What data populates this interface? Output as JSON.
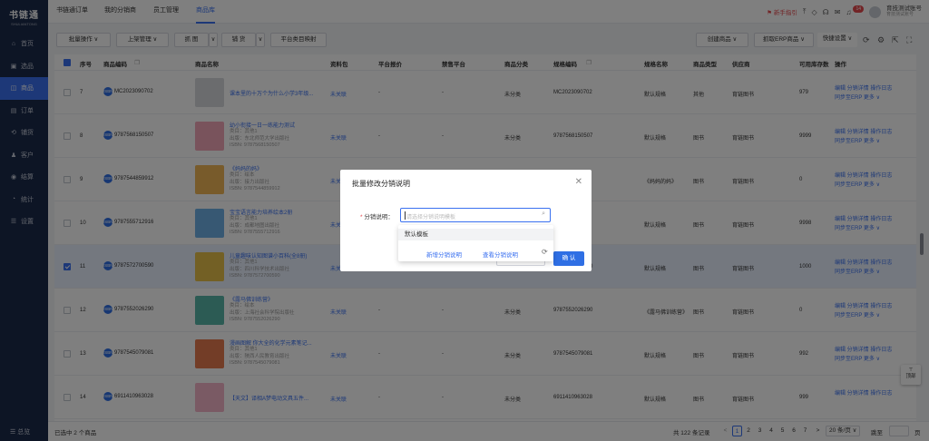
{
  "sidebar": {
    "logo": "书链通",
    "logo_sub": "SHULIANTONG",
    "items": [
      {
        "icon": "home-icon",
        "glyph": "⌂",
        "label": "首页"
      },
      {
        "icon": "selection-icon",
        "glyph": "▣",
        "label": "选品"
      },
      {
        "icon": "product-icon",
        "glyph": "◫",
        "label": "商品"
      },
      {
        "icon": "order-icon",
        "glyph": "▤",
        "label": "订单"
      },
      {
        "icon": "distribution-icon",
        "glyph": "⟲",
        "label": "铺货"
      },
      {
        "icon": "customer-icon",
        "glyph": "♟",
        "label": "客户"
      },
      {
        "icon": "settlement-icon",
        "glyph": "◉",
        "label": "结算"
      },
      {
        "icon": "stats-icon",
        "glyph": "◔",
        "label": "统计"
      },
      {
        "icon": "settings-icon",
        "glyph": "☰",
        "label": "设置"
      }
    ],
    "bottom": "☰ 总览"
  },
  "header": {
    "tabs": [
      "书链通订单",
      "我的分销商",
      "员工管理",
      "商品库"
    ],
    "guide": "新手指引",
    "badge": "14",
    "account_name": "育技测试账号",
    "account_sub": "育技测试账号"
  },
  "toolbar": {
    "batch": "批量操作 ∨",
    "listing": "上架管理 ∨",
    "capture": "抓 图",
    "distribute": "铺 货",
    "platform_map": "平台类目映射",
    "create": "创建商品 ∨",
    "capture_erp": "抓取ERP商品 ∨",
    "quick": "快捷设置 ∨"
  },
  "table": {
    "headers": [
      "序号",
      "商品编码",
      "商品名称",
      "资料包",
      "平台报价",
      "禁售平台",
      "商品分类",
      "规格编码",
      "规格名称",
      "商品类型",
      "供应商",
      "可用库存数",
      "操作"
    ],
    "rows": [
      {
        "no": "7",
        "code": "MC2023090702",
        "name": "课本里的十万个为什么小学3年级...",
        "info": [],
        "pkg": "未关联",
        "price": "-",
        "banned": "-",
        "cat": "未分类",
        "sku": "MC2023090702",
        "spec": "默认规格",
        "type": "其他",
        "supplier": "育链图书",
        "stock": "979",
        "op1": "编辑  分销详情  操作日志",
        "op2": "同步至ERP  更多 ∨",
        "thumb": "#d7d9dd",
        "selected": false
      },
      {
        "no": "8",
        "code": "9787568150507",
        "name": "幼小衔接一日一练能力测试",
        "info": [
          "类目：其他1",
          "出版：东北师范大学出版社",
          "ISBN: 9787568150507"
        ],
        "pkg": "未关联",
        "price": "-",
        "banned": "-",
        "cat": "未分类",
        "sku": "9787568150507",
        "spec": "默认规格",
        "type": "图书",
        "supplier": "育链图书",
        "stock": "9999",
        "op1": "编辑  分销详情  操作日志",
        "op2": "同步至ERP  更多 ∨",
        "thumb": "#f2a6b8",
        "selected": false
      },
      {
        "no": "9",
        "code": "9787544859912",
        "name": "《妈妈的妈》",
        "info": [
          "类目：绘本",
          "出版：接力出版社",
          "ISBN: 9787544859912"
        ],
        "pkg": "未关联",
        "price": "",
        "banned": "",
        "cat": "",
        "sku": "",
        "spec": "《妈妈的妈》",
        "type": "图书",
        "supplier": "育链图书",
        "stock": "0",
        "op1": "编辑  分销详情  操作日志",
        "op2": "同步至ERP  更多 ∨",
        "thumb": "#f0b657",
        "selected": false
      },
      {
        "no": "10",
        "code": "9787555712916",
        "name": "宝宝语言能力培养绘本2册",
        "info": [
          "类目：其他1",
          "出版：成都地图出版社",
          "ISBN: 9787555712916"
        ],
        "pkg": "未关联",
        "price": "",
        "banned": "",
        "cat": "",
        "sku": "",
        "spec": "默认规格",
        "type": "图书",
        "supplier": "育链图书",
        "stock": "9998",
        "op1": "编辑  分销详情  操作日志",
        "op2": "同步至ERP  更多 ∨",
        "thumb": "#6fb0e6",
        "selected": false
      },
      {
        "no": "11",
        "code": "9787572700590",
        "name": "儿童趣味认知图谱小百科(全8册)",
        "info": [
          "类目：其他1",
          "出版：四川科学技术出版社",
          "ISBN: 9787572700590"
        ],
        "pkg": "未关联",
        "price": "-",
        "banned": "-",
        "cat": "未分类",
        "sku": "9787572700590",
        "spec": "默认规格",
        "type": "图书",
        "supplier": "育链图书",
        "stock": "1000",
        "op1": "编辑  分销详情  操作日志",
        "op2": "同步至ERP  更多 ∨",
        "thumb": "#e6c14a",
        "selected": true
      },
      {
        "no": "12",
        "code": "9787552026290",
        "name": "《露马佛训练营》",
        "info": [
          "类目：绘本",
          "出版：上海社会科学院出版社",
          "ISBN: 9787552026290"
        ],
        "pkg": "未关联",
        "price": "-",
        "banned": "-",
        "cat": "未分类",
        "sku": "9787552026290",
        "spec": "《露马佛训练营》",
        "type": "图书",
        "supplier": "育链图书",
        "stock": "0",
        "op1": "编辑  分销详情  操作日志",
        "op2": "同步至ERP  更多 ∨",
        "thumb": "#58b7a8",
        "selected": false
      },
      {
        "no": "13",
        "code": "9787545079081",
        "name": "漫画图解 你大全的化学元素笔记...",
        "info": [
          "类目：其他1",
          "出版：陕西人民教育出版社",
          "ISBN: 9787545079081"
        ],
        "pkg": "未关联",
        "price": "-",
        "banned": "-",
        "cat": "未分类",
        "sku": "9787545079081",
        "spec": "默认规格",
        "type": "图书",
        "supplier": "育链图书",
        "stock": "992",
        "op1": "编辑  分销详情  操作日志",
        "op2": "同步至ERP  更多 ∨",
        "thumb": "#e77a4e",
        "selected": false
      },
      {
        "no": "14",
        "code": "6911410963028",
        "name": "【天文】译相A梦电动文具五件...",
        "info": [],
        "pkg": "未关联",
        "price": "-",
        "banned": "-",
        "cat": "未分类",
        "sku": "6911410963028",
        "spec": "默认规格",
        "type": "图书",
        "supplier": "育链图书",
        "stock": "999",
        "op1": "编辑  分销详情  操作日志",
        "op2": "",
        "thumb": "#f4b5c9",
        "selected": false
      }
    ]
  },
  "footer": {
    "selected": "已选中 2 个商品",
    "total": "共 122 条记录",
    "prev": "<",
    "pages": [
      "1",
      "2",
      "3",
      "4",
      "5",
      "6",
      "7"
    ],
    "next": ">",
    "page_size": "20 条/页 ∨",
    "jump": "跳至",
    "page_unit": "页"
  },
  "back_top": "顶部",
  "modal": {
    "title": "批量修改分销说明",
    "close": "✕",
    "label": "分销说明",
    "required": "*",
    "placeholder": "请选择分销说明模板",
    "option": "默认模板",
    "add_link": "新增分销说明",
    "view_link": "查看分销说明",
    "cancel": "取 消",
    "confirm": "确 认"
  },
  "colors": {
    "primary": "#3a71f0",
    "sidebar": "#1b2a4b",
    "danger": "#e5484d"
  }
}
